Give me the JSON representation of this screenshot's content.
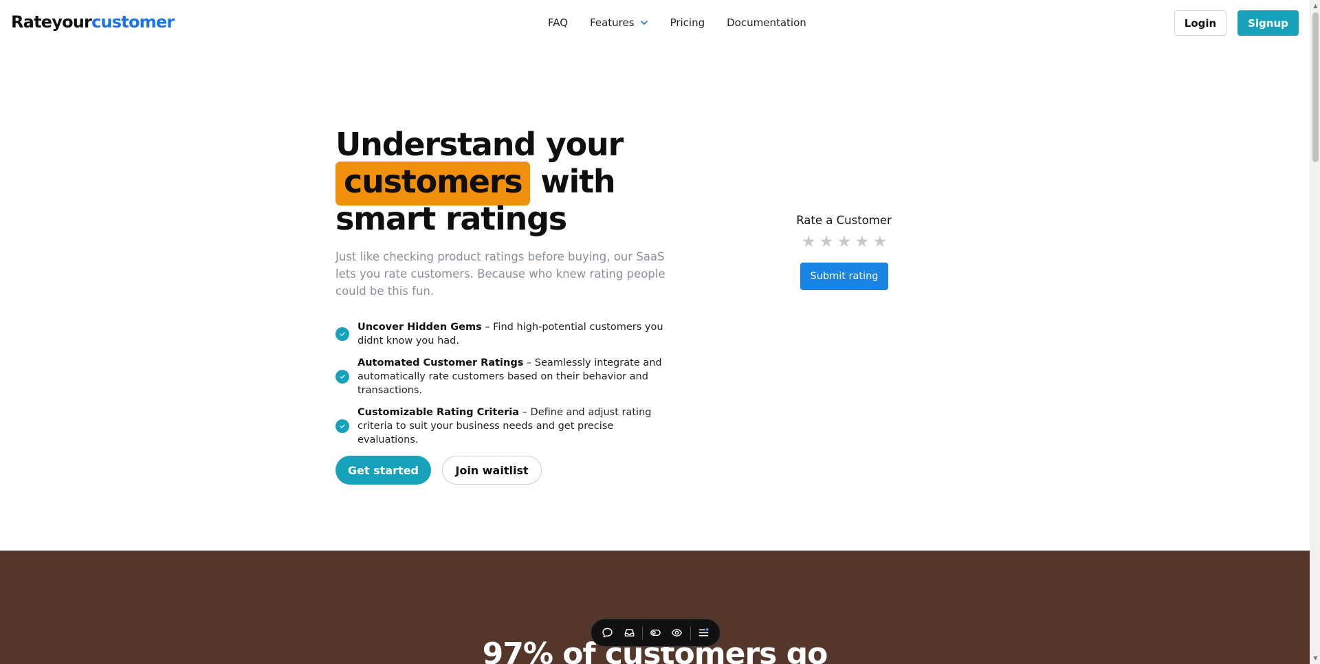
{
  "header": {
    "logo_part1": "Rateyour",
    "logo_part2": "customer",
    "nav": {
      "faq": "FAQ",
      "features": "Features",
      "pricing": "Pricing",
      "documentation": "Documentation"
    },
    "login": "Login",
    "signup": "Signup"
  },
  "hero": {
    "title_line1": "Understand your",
    "title_highlight": "customers",
    "title_after_highlight": " with",
    "title_line3": "smart ratings",
    "subtitle": "Just like checking product ratings before buying, our SaaS lets you rate customers. Because who knew rating people could be this fun.",
    "features": [
      {
        "title": "Uncover Hidden Gems",
        "text": " – Find high-potential customers you didnt know you had."
      },
      {
        "title": "Automated Customer Ratings",
        "text": " – Seamlessly integrate and automatically rate customers based on their behavior and transactions."
      },
      {
        "title": "Customizable Rating Criteria",
        "text": " – Define and adjust rating criteria to suit your business needs and get precise evaluations."
      }
    ],
    "cta_primary": "Get started",
    "cta_secondary": "Join waitlist"
  },
  "rating_widget": {
    "title": "Rate a Customer",
    "stars": [
      "★",
      "★",
      "★",
      "★",
      "★"
    ],
    "rating_value": 0,
    "submit": "Submit rating"
  },
  "stats_section": {
    "heading": "97% of customers go"
  },
  "toolbar": {
    "icons": [
      "comment-icon",
      "inbox-icon",
      "toggle-icon",
      "eye-icon",
      "menu-icon"
    ]
  },
  "colors": {
    "brand_blue": "#1a73e8",
    "teal": "#17a2bb",
    "highlight_orange": "#f0900c",
    "submit_blue": "#1a84e5",
    "brown_section": "#54362b"
  }
}
